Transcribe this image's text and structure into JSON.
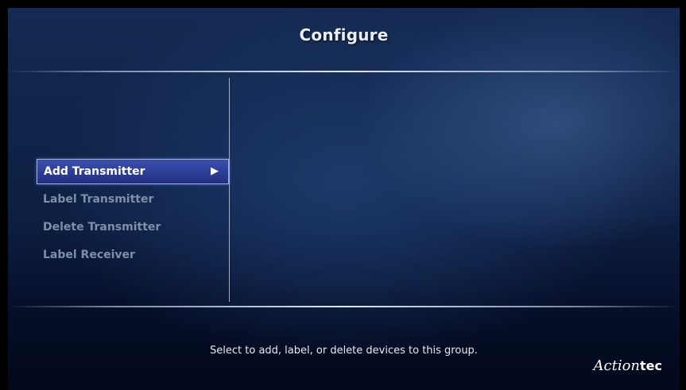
{
  "header": {
    "title": "Configure"
  },
  "menu": {
    "items": [
      {
        "label": "Add Transmitter",
        "selected": true
      },
      {
        "label": "Label Transmitter",
        "selected": false
      },
      {
        "label": "Delete Transmitter",
        "selected": false
      },
      {
        "label": "Label Receiver",
        "selected": false
      }
    ],
    "selected_indicator_icon": "play-arrow-icon",
    "selected_indicator_glyph": "▶"
  },
  "footer": {
    "hint": "Select to add, label, or delete devices to this group.",
    "logo": {
      "script_part": "Action",
      "bold_part": "tec"
    }
  },
  "colors": {
    "selected_item_bg": "#2d3f98",
    "inactive_text": "#7e8fa8",
    "title_text": "#e8eef8"
  }
}
